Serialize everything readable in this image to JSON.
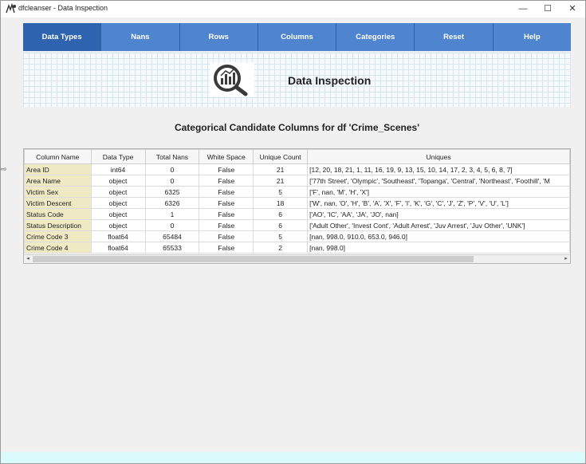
{
  "window": {
    "title": "dfcleanser - Data Inspection",
    "controls": {
      "minimize": "—",
      "maximize": "☐",
      "close": "✕"
    }
  },
  "nav": {
    "items": [
      {
        "label": "Data Types",
        "active": true
      },
      {
        "label": "Nans"
      },
      {
        "label": "Rows"
      },
      {
        "label": "Columns"
      },
      {
        "label": "Categories"
      },
      {
        "label": "Reset"
      },
      {
        "label": "Help"
      }
    ]
  },
  "banner": {
    "title": "Data Inspection",
    "icon": "magnifier-chart-icon"
  },
  "heading": "Categorical Candidate Columns for df 'Crime_Scenes'",
  "table": {
    "columns": [
      "Column Name",
      "Data Type",
      "Total Nans",
      "White Space",
      "Unique Count",
      "Uniques"
    ],
    "rows": [
      [
        "Area ID",
        "int64",
        "0",
        "False",
        "21",
        "[12, 20, 18, 21, 1, 11, 16, 19, 9, 13, 15, 10, 14, 17, 2, 3, 4, 5, 6, 8, 7]"
      ],
      [
        "Area Name",
        "object",
        "0",
        "False",
        "21",
        "['77th Street', 'Olympic', 'Southeast', 'Topanga', 'Central', 'Northeast', 'Foothill', 'M"
      ],
      [
        "Victim Sex",
        "object",
        "6325",
        "False",
        "5",
        "['F', nan, 'M', 'H', 'X']"
      ],
      [
        "Victim Descent",
        "object",
        "6326",
        "False",
        "18",
        "['W', nan, 'O', 'H', 'B', 'A', 'X', 'F', 'I', 'K', 'G', 'C', 'J', 'Z', 'P', 'V', 'U', 'L']"
      ],
      [
        "Status Code",
        "object",
        "1",
        "False",
        "6",
        "['AO', 'IC', 'AA', 'JA', 'JO', nan]"
      ],
      [
        "Status Description",
        "object",
        "0",
        "False",
        "6",
        "['Adult Other', 'Invest Cont', 'Adult Arrest', 'Juv Arrest', 'Juv Other', 'UNK']"
      ],
      [
        "Crime Code 3",
        "float64",
        "65484",
        "False",
        "5",
        "[nan, 998.0, 910.0, 653.0, 946.0]"
      ],
      [
        "Crime Code 4",
        "float64",
        "65533",
        "False",
        "2",
        "[nan, 998.0]"
      ]
    ]
  },
  "scrollbar": {
    "left": "◂",
    "right": "▸"
  },
  "side_arrow": "⇨",
  "colors": {
    "nav": "#4f84cf",
    "nav_active": "#2e63b0",
    "name_cell": "#efeac3",
    "bottom_strip": "#d9fbfb"
  }
}
